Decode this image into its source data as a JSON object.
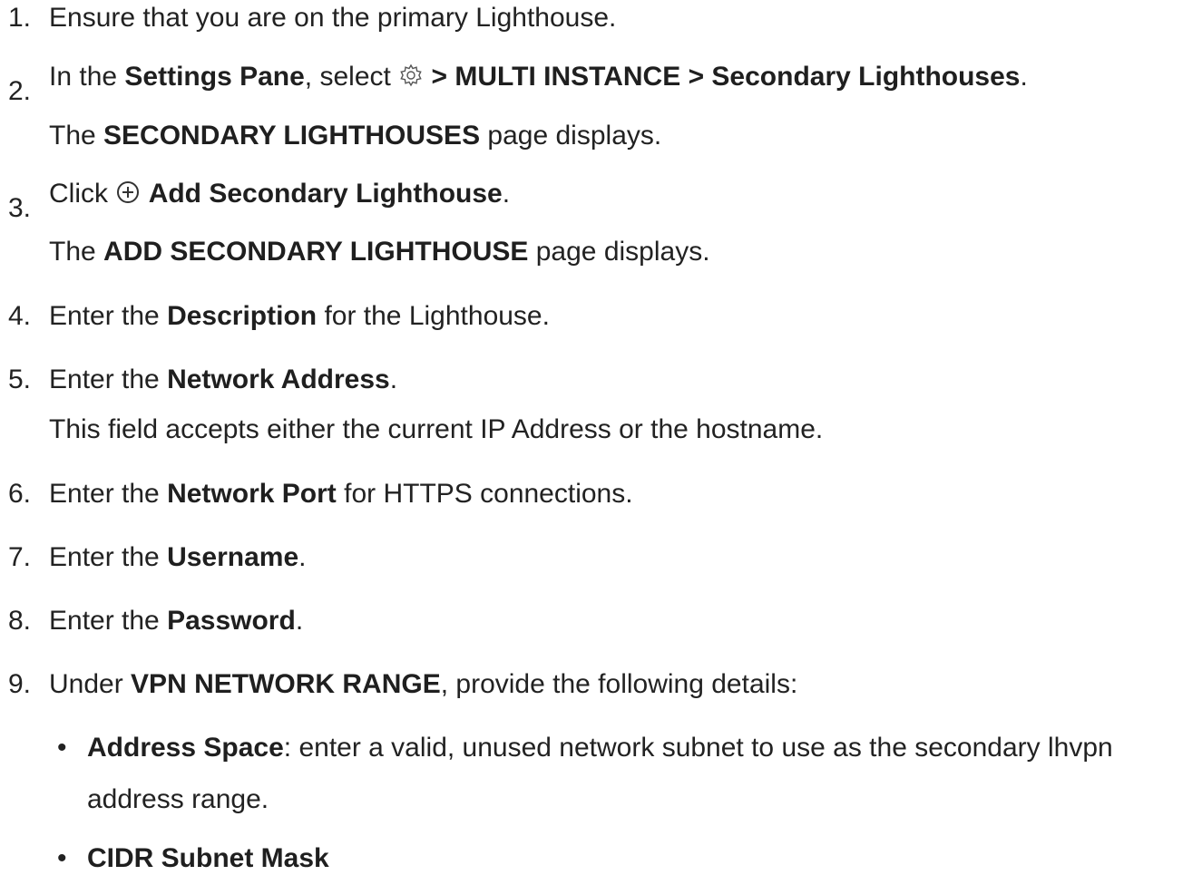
{
  "steps": [
    {
      "num": "1.",
      "pre": "Ensure that you are on the primary Lighthouse."
    },
    {
      "num": "2.",
      "pre": "In the ",
      "b1": "Settings Pane",
      "mid": ", select ",
      "icon": "gear-icon",
      "b2": "> MULTI INSTANCE > Secondary Lighthouses",
      "post": ".",
      "sub_pre": "The ",
      "sub_b": "SECONDARY LIGHTHOUSES",
      "sub_post": " page displays."
    },
    {
      "num": "3.",
      "pre": "Click ",
      "icon": "plus-circle-icon",
      "b1": "Add Secondary Lighthouse",
      "post": ".",
      "sub_pre": "The ",
      "sub_b": "ADD SECONDARY LIGHTHOUSE",
      "sub_post": " page displays."
    },
    {
      "num": "4.",
      "pre": "Enter the ",
      "b1": "Description",
      "post": " for the Lighthouse."
    },
    {
      "num": "5.",
      "pre": "Enter the ",
      "b1": "Network Address",
      "post": ".",
      "sub": "This field accepts either the current IP Address or the hostname."
    },
    {
      "num": "6.",
      "pre": "Enter the ",
      "b1": "Network Port",
      "post": " for HTTPS connections."
    },
    {
      "num": "7.",
      "pre": "Enter the ",
      "b1": "Username",
      "post": "."
    },
    {
      "num": "8.",
      "pre": "Enter the ",
      "b1": "Password",
      "post": "."
    },
    {
      "num": "9.",
      "pre": "Under ",
      "b1": "VPN NETWORK RANGE",
      "post": ", provide the following details:"
    }
  ],
  "bullets": [
    {
      "dot": "•",
      "b": "Address Space",
      "text": ": enter a valid, unused network subnet to use as the secondary lhvpn",
      "cont": "address range."
    },
    {
      "dot": "•",
      "b": "CIDR Subnet Mask"
    }
  ]
}
